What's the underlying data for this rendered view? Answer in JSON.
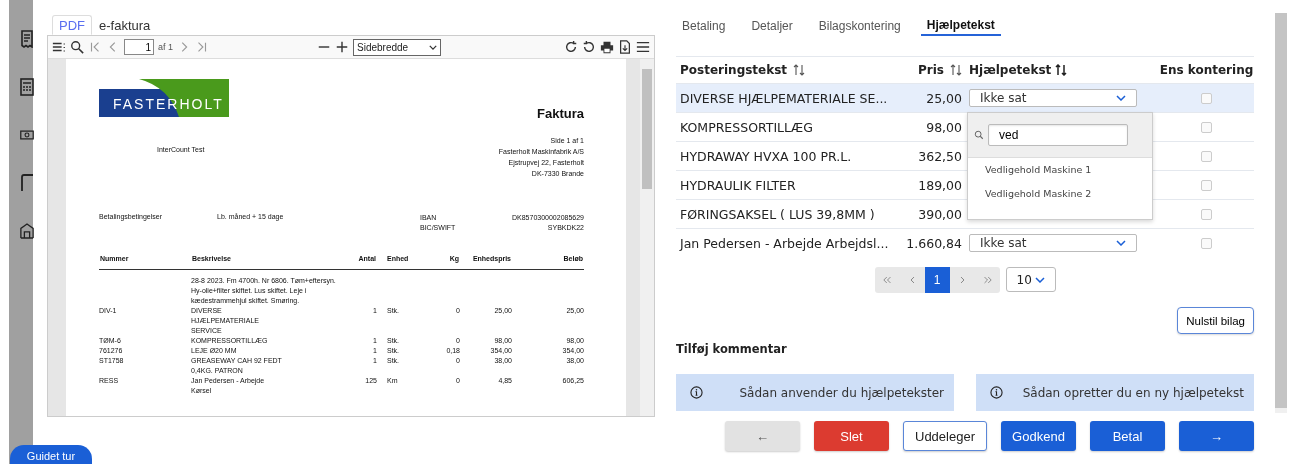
{
  "viewer_tabs": [
    {
      "label": "PDF",
      "selected": true
    },
    {
      "label": "e-faktura",
      "selected": false
    }
  ],
  "pdf_toolbar": {
    "page": "1",
    "page_count": "af 1",
    "zoom": "Sidebredde"
  },
  "invoice": {
    "logo": "FASTERHOLT",
    "title": "Faktura",
    "recipient": "InterCount Test",
    "sender": [
      "Side 1 af 1",
      "Fasterholt Maskinfabrik A/S",
      "Ejstrupvej 22, Fasterholt",
      "DK-7330 Brande"
    ],
    "terms": {
      "label": "Betalingsbetingelser",
      "value": "Lb. måned + 15 dage"
    },
    "bank": [
      {
        "label": "IBAN",
        "value": "DK8570300002085629"
      },
      {
        "label": "BIC/SWIFT",
        "value": "SYBKDK22"
      }
    ],
    "columns": [
      "Nummer",
      "Beskrivelse",
      "Antal",
      "Enhed",
      "Kg",
      "Enhedspris",
      "Beløb"
    ],
    "rows": [
      {
        "cells": [
          "",
          [
            "28-8 2023. Fm 4700h. Nr 6806. Tøm+eftersyn.",
            "Hy-olie+filter skiftet. Lus skiftet. Leje i",
            "kædestrammehjul skiftet. Smøring."
          ],
          "",
          "",
          "",
          "",
          ""
        ]
      },
      {
        "cells": [
          "DIV-1",
          [
            "DIVERSE",
            "HJÆLPEMATERIALE",
            "SERVICE"
          ],
          "1",
          "Stk.",
          "0",
          "25,00",
          "25,00"
        ]
      },
      {
        "cells": [
          "TØM-6",
          [
            "KOMPRESSORTILLÆG"
          ],
          "1",
          "Stk.",
          "0",
          "98,00",
          "98,00"
        ]
      },
      {
        "cells": [
          "761276",
          [
            "LEJE Ø20 MM"
          ],
          "1",
          "Stk.",
          "0,18",
          "354,00",
          "354,00"
        ]
      },
      {
        "cells": [
          "ST1758",
          [
            "GREASEWAY CAH 92 FEDT",
            "0,4KG. PATRON"
          ],
          "1",
          "Stk.",
          "0",
          "38,00",
          "38,00"
        ]
      },
      {
        "cells": [
          "RESS",
          [
            "Jan Pedersen - Arbejde",
            "Kørsel"
          ],
          "125",
          "Km",
          "0",
          "4,85",
          "606,25"
        ]
      }
    ]
  },
  "tabs": [
    {
      "label": "Betaling",
      "selected": false
    },
    {
      "label": "Detaljer",
      "selected": false
    },
    {
      "label": "Bilagskontering",
      "selected": false
    },
    {
      "label": "Hjælpetekst",
      "selected": true
    }
  ],
  "table": {
    "columns": [
      "Posteringstekst",
      "Pris",
      "Hjælpetekst",
      "Ens kontering"
    ],
    "rows": [
      {
        "text": "DIVERSE HJÆLPEMATERIALE SE...",
        "price": "25,00",
        "help": "Ikke sat",
        "selected": true,
        "checked": false
      },
      {
        "text": "KOMPRESSORTILLÆG",
        "price": "98,00",
        "selected": false,
        "checked": false
      },
      {
        "text": "HYDRAWAY HVXA 100 PR.L.",
        "price": "362,50",
        "selected": false,
        "checked": false
      },
      {
        "text": "HYDRAULIK FILTER",
        "price": "189,00",
        "selected": false,
        "checked": false
      },
      {
        "text": "FØRINGSAKSEL ( LUS 39,8MM )",
        "price": "390,00",
        "selected": false,
        "checked": false
      },
      {
        "text": "Jan Pedersen - Arbejde Arbejdsl...",
        "price": "1.660,84",
        "help": "Ikke sat",
        "selected": false,
        "checked": false
      }
    ]
  },
  "dropdown": {
    "search": "ved",
    "options": [
      "Vedligehold Maskine 1",
      "Vedligehold Maskine 2"
    ]
  },
  "pagination": {
    "pages": [
      {
        "label": "1",
        "selected": true
      }
    ],
    "page_size": "10"
  },
  "reset_button": "Nulstil bilag",
  "comment_label": "Tilføj kommentar",
  "help_links": [
    "Sådan anvender du hjælpetekster",
    "Sådan opretter du en ny hjælpetekst"
  ],
  "actions": [
    {
      "kind": "back",
      "label": "←"
    },
    {
      "kind": "danger",
      "label": "Slet"
    },
    {
      "kind": "outline",
      "label": "Uddeleger"
    },
    {
      "kind": "primary",
      "label": "Godkend"
    },
    {
      "kind": "primary",
      "label": "Betal"
    },
    {
      "kind": "primary",
      "label": "→"
    }
  ],
  "tour_button": "Guidet tur"
}
